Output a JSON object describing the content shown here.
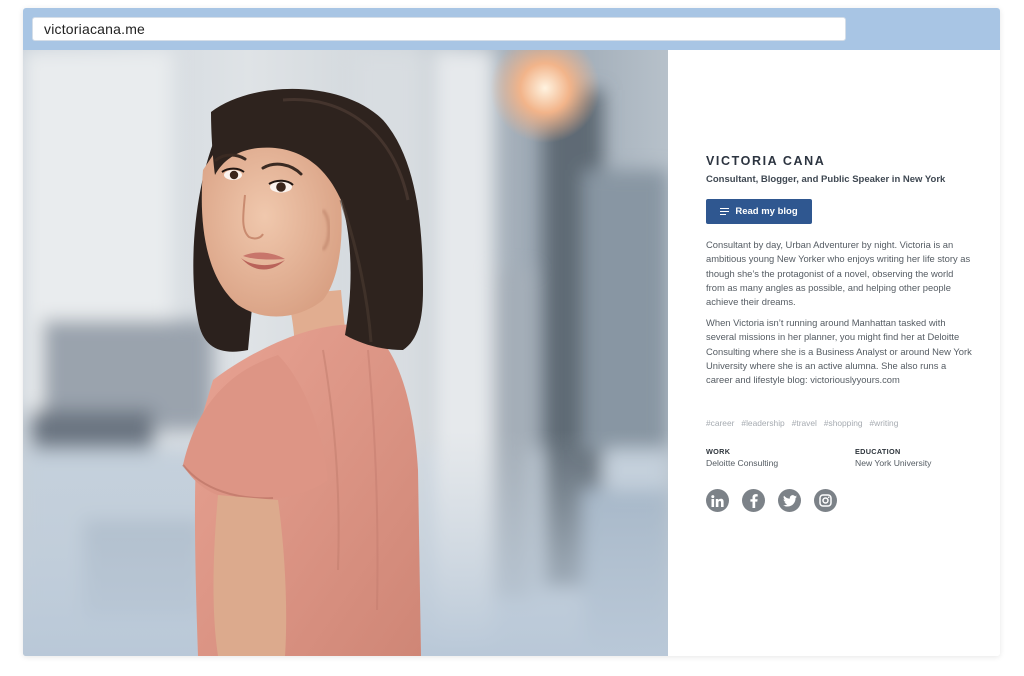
{
  "browser": {
    "url": "victoriacana.me"
  },
  "profile": {
    "name": "VICTORIA CANA",
    "tagline": "Consultant, Blogger, and Public Speaker in New York",
    "blog_button_label": "Read my blog",
    "bio": [
      "Consultant by day, Urban Adventurer by night. Victoria is an ambitious young New Yorker who enjoys writing her life story as though she’s the protagonist of a novel, observing the world from as many angles as possible, and helping other people achieve their dreams.",
      "When Victoria isn’t running around Manhattan tasked with several missions in her planner, you might find her at Deloitte Consulting where she is a Business Analyst or around New York University where she is an active alumna. She also runs a career and lifestyle blog: victoriouslyyours.com"
    ],
    "tags": [
      "#career",
      "#leadership",
      "#travel",
      "#shopping",
      "#writing"
    ],
    "work": {
      "label": "WORK",
      "value": "Deloitte Consulting"
    },
    "education": {
      "label": "EDUCATION",
      "value": "New York University"
    },
    "socials": [
      "linkedin-icon",
      "facebook-icon",
      "twitter-icon",
      "instagram-icon"
    ]
  },
  "colors": {
    "browser_bar": "#a8c5e4",
    "button": "#2f5790",
    "social_icon": "#7c8288"
  }
}
